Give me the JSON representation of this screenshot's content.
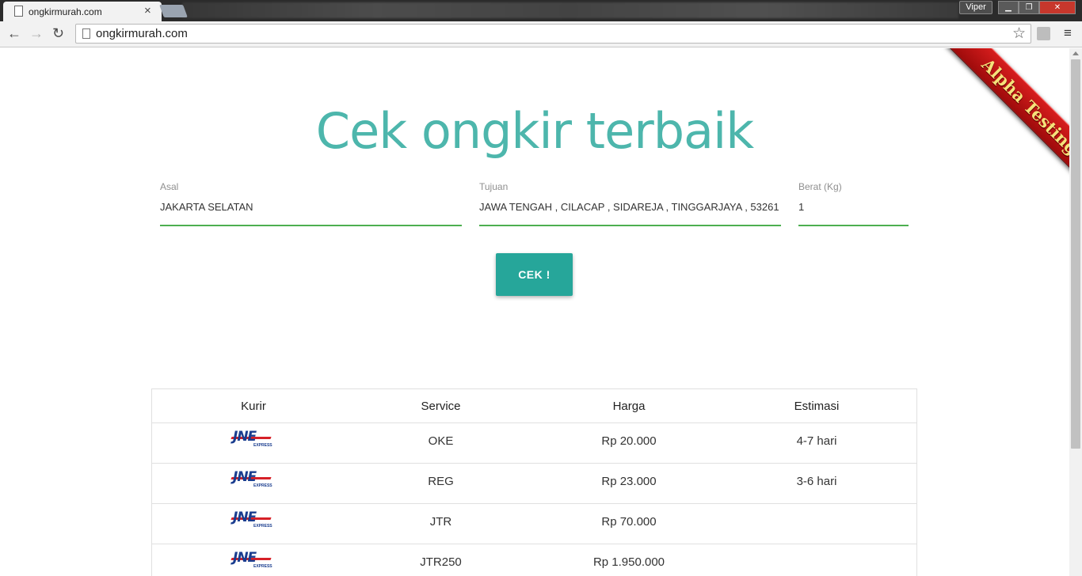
{
  "browser": {
    "tab_title": "ongkirmurah.com",
    "tab_close": "×",
    "profile_name": "Viper",
    "url": "ongkirmurah.com",
    "back_glyph": "←",
    "forward_glyph": "→",
    "reload_glyph": "↻",
    "star_glyph": "☆",
    "menu_glyph": "≡",
    "minimize_glyph": "▁",
    "maximize_glyph": "❐",
    "close_glyph": "✕"
  },
  "ribbon": {
    "text": "Alpha Testing"
  },
  "page": {
    "title": "Cek ongkir terbaik",
    "form": {
      "asal_label": "Asal",
      "asal_value": "JAKARTA SELATAN",
      "tujuan_label": "Tujuan",
      "tujuan_value": "JAWA TENGAH , CILACAP , SIDAREJA , TINGGARJAYA , 53261",
      "berat_label": "Berat (Kg)",
      "berat_value": "1"
    },
    "cek_button": "CEK !"
  },
  "table": {
    "headers": [
      "Kurir",
      "Service",
      "Harga",
      "Estimasi"
    ],
    "logo_text": "JNE",
    "logo_sub": "EXPRESS",
    "rows": [
      {
        "service": "OKE",
        "harga": "Rp 20.000",
        "estimasi": "4-7 hari"
      },
      {
        "service": "REG",
        "harga": "Rp 23.000",
        "estimasi": "3-6 hari"
      },
      {
        "service": "JTR",
        "harga": "Rp 70.000",
        "estimasi": ""
      },
      {
        "service": "JTR250",
        "harga": "Rp 1.950.000",
        "estimasi": ""
      }
    ]
  },
  "colors": {
    "accent_teal": "#26a69a",
    "title_teal": "#4db6ac",
    "input_underline": "#4caf50",
    "ribbon_red": "#c41616"
  }
}
